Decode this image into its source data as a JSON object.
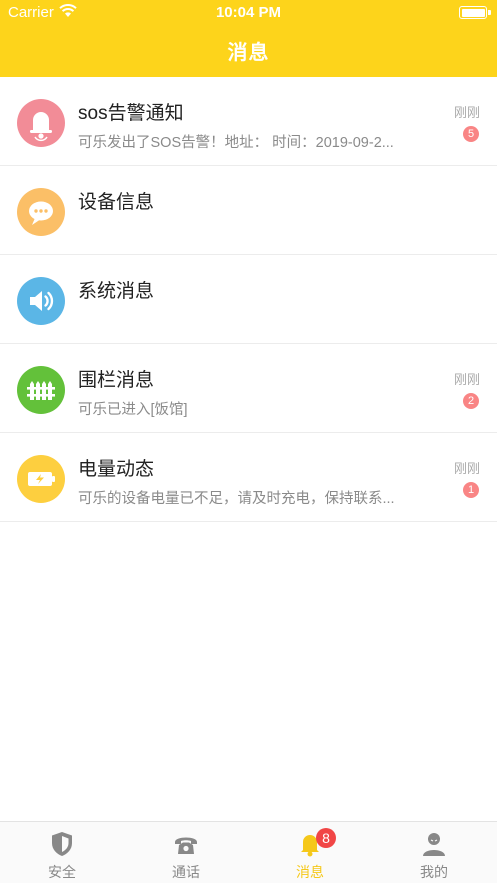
{
  "status_bar": {
    "carrier": "Carrier",
    "time": "10:04 PM"
  },
  "header": {
    "title": "消息"
  },
  "messages": [
    {
      "title": "sos告警通知",
      "subtitle": "可乐发出了SOS告警！地址： 时间：2019-09-2...",
      "time": "刚刚",
      "badge": "5",
      "icon": "alarm-bell-icon",
      "icon_color": "#f28c97"
    },
    {
      "title": "设备信息",
      "subtitle": "",
      "time": "",
      "badge": "",
      "icon": "chat-bubble-icon",
      "icon_color": "#fbbf67"
    },
    {
      "title": "系统消息",
      "subtitle": "",
      "time": "",
      "badge": "",
      "icon": "speaker-icon",
      "icon_color": "#5bb6e6"
    },
    {
      "title": "围栏消息",
      "subtitle": "可乐已进入[饭馆]",
      "time": "刚刚",
      "badge": "2",
      "icon": "fence-icon",
      "icon_color": "#63c13a"
    },
    {
      "title": "电量动态",
      "subtitle": "可乐的设备电量已不足，请及时充电，保持联系...",
      "time": "刚刚",
      "badge": "1",
      "icon": "battery-charge-icon",
      "icon_color": "#fdcf3f"
    }
  ],
  "tabbar": {
    "tabs": [
      {
        "label": "安全",
        "icon": "shield-icon"
      },
      {
        "label": "通话",
        "icon": "phone-icon"
      },
      {
        "label": "消息",
        "icon": "bell-icon",
        "badge": "8",
        "active": true
      },
      {
        "label": "我的",
        "icon": "user-icon"
      }
    ]
  },
  "colors": {
    "brand": "#fdd41b",
    "badge_light": "#f98585",
    "badge_tab": "#f14646"
  }
}
